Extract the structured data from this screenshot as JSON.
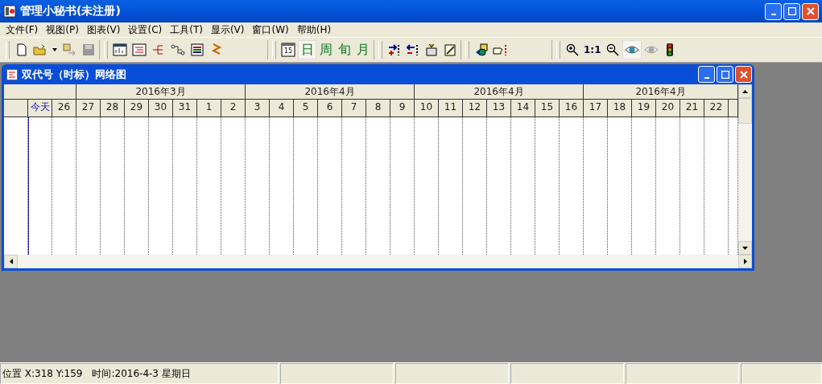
{
  "window": {
    "title": "管理小秘书(未注册)"
  },
  "menu": [
    "文件(F)",
    "视图(P)",
    "图表(V)",
    "设置(C)",
    "工具(T)",
    "显示(V)",
    "窗口(W)",
    "帮助(H)"
  ],
  "toolbar": {
    "calendar_badge": "15",
    "view_buttons": [
      {
        "label": "日",
        "selected": true
      },
      {
        "label": "周",
        "selected": false
      },
      {
        "label": "旬",
        "selected": false
      },
      {
        "label": "月",
        "selected": false
      }
    ],
    "zoom_reset": "1:1"
  },
  "child_window": {
    "title": "双代号（时标）网络图",
    "timeline": {
      "today": "今天",
      "lead_days": [
        "26"
      ],
      "months": [
        {
          "label": "2016年3月",
          "days": [
            "27",
            "28",
            "29",
            "30",
            "31",
            "1",
            "2"
          ]
        },
        {
          "label": "2016年4月",
          "days": [
            "3",
            "4",
            "5",
            "6",
            "7",
            "8",
            "9"
          ]
        },
        {
          "label": "2016年4月",
          "days": [
            "10",
            "11",
            "12",
            "13",
            "14",
            "15",
            "16"
          ]
        },
        {
          "label": "2016年4月",
          "days": [
            "17",
            "18",
            "19",
            "20",
            "21",
            "22"
          ]
        }
      ]
    }
  },
  "status_bar": {
    "position": "位置 X:318 Y:159",
    "time": "时间:2016-4-3 星期日"
  }
}
